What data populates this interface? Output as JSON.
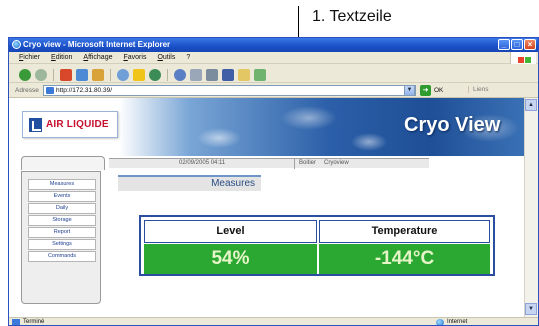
{
  "annotation": {
    "label": "1. Textzeile"
  },
  "window": {
    "title": "Cryo view - Microsoft Internet Explorer",
    "controls": [
      "_",
      "□",
      "×"
    ]
  },
  "menu": [
    "Fichier",
    "Edition",
    "Affichage",
    "Favoris",
    "Outils",
    "?"
  ],
  "address": {
    "label": "Adresse",
    "url": "http://172.31.80.39/",
    "go_label": "OK",
    "links_label": "Liens"
  },
  "banner": {
    "logo_text": "AIR LIQUIDE",
    "app_title": "Cryo View"
  },
  "nav": {
    "datetime": "02/09/2005 04:11",
    "links": [
      "Boitier",
      "Cryoview"
    ]
  },
  "sidebar": {
    "items": [
      "Measures",
      "Events",
      "Daily",
      "Storage",
      "Report",
      "Settings",
      "Commands"
    ]
  },
  "main": {
    "section_title": "Measures",
    "table": {
      "headers": [
        "Level",
        "Temperature"
      ],
      "values": [
        "54%",
        "-144°C"
      ]
    }
  },
  "status": {
    "left_text": "Terminé",
    "zone_text": "Internet"
  },
  "colors": {
    "titlebar": "#1a50c8",
    "value_cell": "#2aa832",
    "table_border": "#2b4fa0",
    "logo_red": "#c8102e"
  }
}
